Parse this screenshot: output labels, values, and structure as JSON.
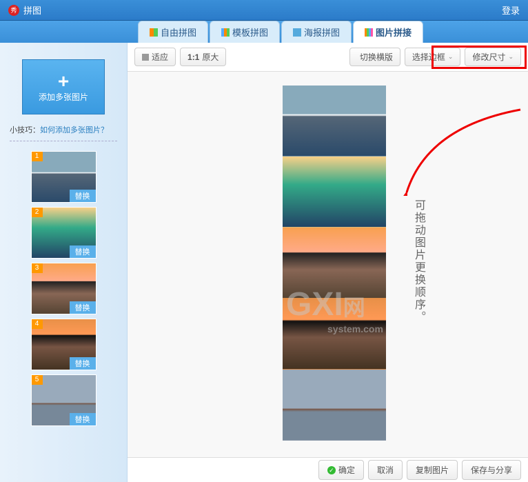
{
  "titlebar": {
    "app": "拼图",
    "login": "登录"
  },
  "tabs": [
    {
      "label": "自由拼图",
      "icon": "grid"
    },
    {
      "label": "模板拼图",
      "icon": "tpl"
    },
    {
      "label": "海报拼图",
      "icon": "post"
    },
    {
      "label": "图片拼接",
      "icon": "join",
      "active": true
    }
  ],
  "sidebar": {
    "add": "添加多张图片",
    "tip_prefix": "小技巧：",
    "tip_link": "如何添加多张图片？",
    "replace": "替换",
    "thumbs": [
      {
        "n": "1",
        "cls": "i-ship"
      },
      {
        "n": "2",
        "cls": "i-lake"
      },
      {
        "n": "3",
        "cls": "i-sail1"
      },
      {
        "n": "4",
        "cls": "i-sail2"
      },
      {
        "n": "5",
        "cls": "i-boat"
      }
    ]
  },
  "toolbar": {
    "fit": "适应",
    "orig_pre": "1:1",
    "orig": "原大",
    "switch": "切换横版",
    "border": "选择边框",
    "resize": "修改尺寸"
  },
  "canvas": {
    "items": [
      "i-ship",
      "i-lake",
      "i-sail1",
      "i-sail2",
      "i-boat"
    ],
    "note": "可拖动图片更换顺序。"
  },
  "footer": {
    "ok": "确定",
    "cancel": "取消",
    "copy": "复制图片",
    "save": "保存与分享"
  },
  "watermark": {
    "t1": "GXI",
    "t2": "网",
    "sub": "system.com"
  }
}
